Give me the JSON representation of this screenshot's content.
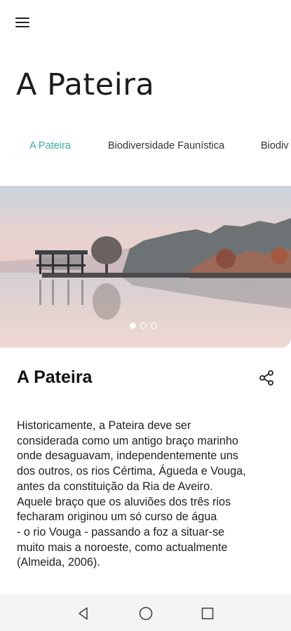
{
  "header": {
    "menu_icon": "hamburger-menu-icon",
    "title": "A Pateira"
  },
  "tabs": [
    {
      "label": "A Pateira",
      "active": true
    },
    {
      "label": "Biodiversidade Faunística",
      "active": false
    },
    {
      "label": "Biodiv",
      "active": false
    }
  ],
  "colors": {
    "accent": "#3aa7a6",
    "text": "#1a1a1a",
    "navbar": "#f4f4f4"
  },
  "carousel": {
    "image": "lake-with-pier-and-trees",
    "page_count": 3,
    "current_page": 1
  },
  "content": {
    "title": "A Pateira",
    "share_icon": "share-icon",
    "lines": [
      "Historicamente, a Pateira deve ser",
      "considerada como um antigo braço marinho",
      "onde desaguavam, independentemente uns",
      "dos outros, os rios Cértima, Águeda e Vouga,",
      "antes da constituição da Ria de Aveiro.",
      "Aquele braço que os aluviões dos três rios",
      "fecharam originou um só curso de água",
      "- o rio Vouga - passando a foz a situar-se",
      "muito mais a noroeste, como actualmente",
      "(Almeida, 2006)."
    ]
  },
  "system_nav": {
    "back_icon": "back-triangle-icon",
    "home_icon": "home-circle-icon",
    "recents_icon": "recents-square-icon"
  }
}
